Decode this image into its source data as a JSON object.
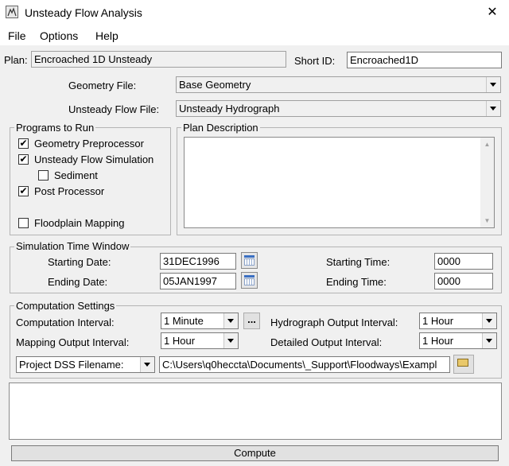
{
  "window": {
    "title": "Unsteady Flow Analysis",
    "close": "✕"
  },
  "menu": {
    "file": "File",
    "options": "Options",
    "help": "Help"
  },
  "plan": {
    "label": "Plan:",
    "value": "Encroached 1D Unsteady",
    "short_id_label": "Short ID:",
    "short_id_value": "Encroached1D"
  },
  "geometry": {
    "label": "Geometry File:",
    "value": "Base Geometry"
  },
  "unsteady": {
    "label": "Unsteady Flow File:",
    "value": "Unsteady Hydrograph"
  },
  "programs": {
    "title": "Programs to Run",
    "items": [
      {
        "label": "Geometry Preprocessor",
        "checked": true
      },
      {
        "label": "Unsteady Flow Simulation",
        "checked": true
      },
      {
        "label": "Sediment",
        "checked": false
      },
      {
        "label": "Post Processor",
        "checked": true
      },
      {
        "label": "Floodplain Mapping",
        "checked": false
      }
    ]
  },
  "plan_description": {
    "title": "Plan Description",
    "text": ""
  },
  "sim_window": {
    "title": "Simulation Time Window",
    "start_date_label": "Starting Date:",
    "start_date": "31DEC1996",
    "end_date_label": "Ending Date:",
    "end_date": "05JAN1997",
    "start_time_label": "Starting Time:",
    "start_time": "0000",
    "end_time_label": "Ending Time:",
    "end_time": "0000"
  },
  "comp": {
    "title": "Computation Settings",
    "interval_label": "Computation Interval:",
    "interval": "1 Minute",
    "ellipsis": "...",
    "hydro_label": "Hydrograph Output Interval:",
    "hydro": "1 Hour",
    "mapping_label": "Mapping Output Interval:",
    "mapping": "1 Hour",
    "detailed_label": "Detailed Output Interval:",
    "detailed": "1 Hour",
    "dss_select": "Project DSS Filename:",
    "dss_path": "C:\\Users\\q0heccta\\Documents\\_Support\\Floodways\\Exampl"
  },
  "compute_button": "Compute",
  "check_mark": "✔",
  "icons": {
    "app": "river-icon",
    "calendar": "calendar-icon",
    "folder": "folder-open-icon"
  }
}
